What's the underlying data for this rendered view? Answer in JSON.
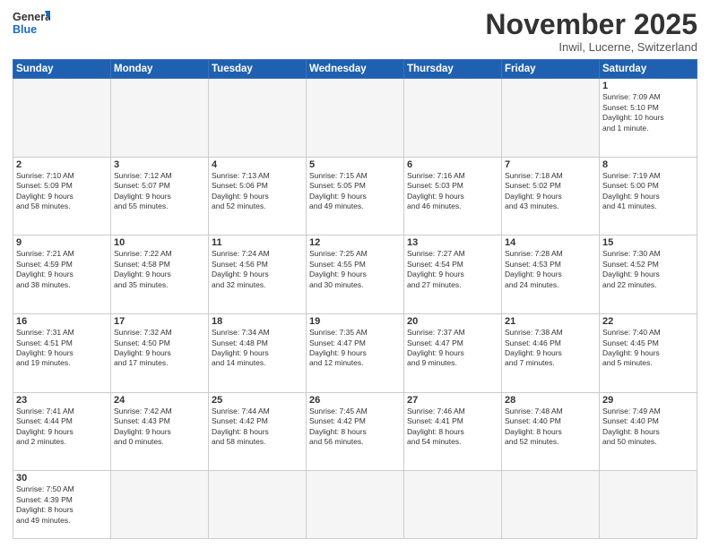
{
  "logo": {
    "line1": "General",
    "line2": "Blue"
  },
  "title": "November 2025",
  "subtitle": "Inwil, Lucerne, Switzerland",
  "weekdays": [
    "Sunday",
    "Monday",
    "Tuesday",
    "Wednesday",
    "Thursday",
    "Friday",
    "Saturday"
  ],
  "weeks": [
    [
      {
        "day": null,
        "info": ""
      },
      {
        "day": null,
        "info": ""
      },
      {
        "day": null,
        "info": ""
      },
      {
        "day": null,
        "info": ""
      },
      {
        "day": null,
        "info": ""
      },
      {
        "day": null,
        "info": ""
      },
      {
        "day": "1",
        "info": "Sunrise: 7:09 AM\nSunset: 5:10 PM\nDaylight: 10 hours\nand 1 minute."
      }
    ],
    [
      {
        "day": "2",
        "info": "Sunrise: 7:10 AM\nSunset: 5:09 PM\nDaylight: 9 hours\nand 58 minutes."
      },
      {
        "day": "3",
        "info": "Sunrise: 7:12 AM\nSunset: 5:07 PM\nDaylight: 9 hours\nand 55 minutes."
      },
      {
        "day": "4",
        "info": "Sunrise: 7:13 AM\nSunset: 5:06 PM\nDaylight: 9 hours\nand 52 minutes."
      },
      {
        "day": "5",
        "info": "Sunrise: 7:15 AM\nSunset: 5:05 PM\nDaylight: 9 hours\nand 49 minutes."
      },
      {
        "day": "6",
        "info": "Sunrise: 7:16 AM\nSunset: 5:03 PM\nDaylight: 9 hours\nand 46 minutes."
      },
      {
        "day": "7",
        "info": "Sunrise: 7:18 AM\nSunset: 5:02 PM\nDaylight: 9 hours\nand 43 minutes."
      },
      {
        "day": "8",
        "info": "Sunrise: 7:19 AM\nSunset: 5:00 PM\nDaylight: 9 hours\nand 41 minutes."
      }
    ],
    [
      {
        "day": "9",
        "info": "Sunrise: 7:21 AM\nSunset: 4:59 PM\nDaylight: 9 hours\nand 38 minutes."
      },
      {
        "day": "10",
        "info": "Sunrise: 7:22 AM\nSunset: 4:58 PM\nDaylight: 9 hours\nand 35 minutes."
      },
      {
        "day": "11",
        "info": "Sunrise: 7:24 AM\nSunset: 4:56 PM\nDaylight: 9 hours\nand 32 minutes."
      },
      {
        "day": "12",
        "info": "Sunrise: 7:25 AM\nSunset: 4:55 PM\nDaylight: 9 hours\nand 30 minutes."
      },
      {
        "day": "13",
        "info": "Sunrise: 7:27 AM\nSunset: 4:54 PM\nDaylight: 9 hours\nand 27 minutes."
      },
      {
        "day": "14",
        "info": "Sunrise: 7:28 AM\nSunset: 4:53 PM\nDaylight: 9 hours\nand 24 minutes."
      },
      {
        "day": "15",
        "info": "Sunrise: 7:30 AM\nSunset: 4:52 PM\nDaylight: 9 hours\nand 22 minutes."
      }
    ],
    [
      {
        "day": "16",
        "info": "Sunrise: 7:31 AM\nSunset: 4:51 PM\nDaylight: 9 hours\nand 19 minutes."
      },
      {
        "day": "17",
        "info": "Sunrise: 7:32 AM\nSunset: 4:50 PM\nDaylight: 9 hours\nand 17 minutes."
      },
      {
        "day": "18",
        "info": "Sunrise: 7:34 AM\nSunset: 4:48 PM\nDaylight: 9 hours\nand 14 minutes."
      },
      {
        "day": "19",
        "info": "Sunrise: 7:35 AM\nSunset: 4:47 PM\nDaylight: 9 hours\nand 12 minutes."
      },
      {
        "day": "20",
        "info": "Sunrise: 7:37 AM\nSunset: 4:47 PM\nDaylight: 9 hours\nand 9 minutes."
      },
      {
        "day": "21",
        "info": "Sunrise: 7:38 AM\nSunset: 4:46 PM\nDaylight: 9 hours\nand 7 minutes."
      },
      {
        "day": "22",
        "info": "Sunrise: 7:40 AM\nSunset: 4:45 PM\nDaylight: 9 hours\nand 5 minutes."
      }
    ],
    [
      {
        "day": "23",
        "info": "Sunrise: 7:41 AM\nSunset: 4:44 PM\nDaylight: 9 hours\nand 2 minutes."
      },
      {
        "day": "24",
        "info": "Sunrise: 7:42 AM\nSunset: 4:43 PM\nDaylight: 9 hours\nand 0 minutes."
      },
      {
        "day": "25",
        "info": "Sunrise: 7:44 AM\nSunset: 4:42 PM\nDaylight: 8 hours\nand 58 minutes."
      },
      {
        "day": "26",
        "info": "Sunrise: 7:45 AM\nSunset: 4:42 PM\nDaylight: 8 hours\nand 56 minutes."
      },
      {
        "day": "27",
        "info": "Sunrise: 7:46 AM\nSunset: 4:41 PM\nDaylight: 8 hours\nand 54 minutes."
      },
      {
        "day": "28",
        "info": "Sunrise: 7:48 AM\nSunset: 4:40 PM\nDaylight: 8 hours\nand 52 minutes."
      },
      {
        "day": "29",
        "info": "Sunrise: 7:49 AM\nSunset: 4:40 PM\nDaylight: 8 hours\nand 50 minutes."
      }
    ],
    [
      {
        "day": "30",
        "info": "Sunrise: 7:50 AM\nSunset: 4:39 PM\nDaylight: 8 hours\nand 49 minutes."
      },
      {
        "day": null,
        "info": ""
      },
      {
        "day": null,
        "info": ""
      },
      {
        "day": null,
        "info": ""
      },
      {
        "day": null,
        "info": ""
      },
      {
        "day": null,
        "info": ""
      },
      {
        "day": null,
        "info": ""
      }
    ]
  ]
}
